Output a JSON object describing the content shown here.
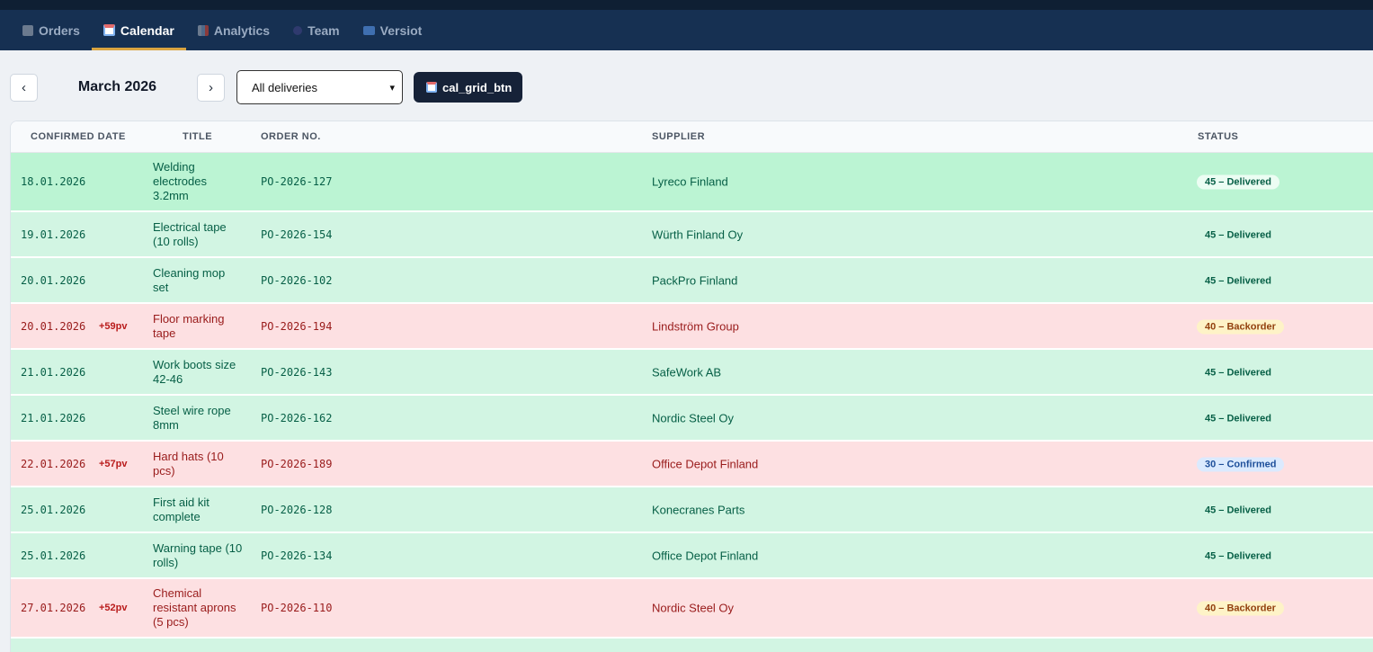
{
  "nav": {
    "tabs": [
      {
        "label": "Orders",
        "icon": "clipboard-icon"
      },
      {
        "label": "Calendar",
        "icon": "calendar-icon",
        "active": true
      },
      {
        "label": "Analytics",
        "icon": "bar-chart-icon"
      },
      {
        "label": "Team",
        "icon": "people-icon"
      },
      {
        "label": "Versiot",
        "icon": "version-icon"
      }
    ]
  },
  "toolbar": {
    "prev_label": "‹",
    "next_label": "›",
    "month": "March 2026",
    "filter_value": "All deliveries",
    "grid_button_label": "cal_grid_btn"
  },
  "table": {
    "headers": {
      "date": "CONFIRMED DATE",
      "title": "TITLE",
      "order": "ORDER NO.",
      "supplier": "SUPPLIER",
      "status": "STATUS"
    },
    "rows": [
      {
        "date": "18.01.2026",
        "late": "",
        "title": "Welding electrodes 3.2mm",
        "order": "PO-2026-127",
        "supplier": "Lyreco Finland",
        "status": "45 – Delivered",
        "tone": "green"
      },
      {
        "date": "19.01.2026",
        "late": "",
        "title": "Electrical tape (10 rolls)",
        "order": "PO-2026-154",
        "supplier": "Würth Finland Oy",
        "status": "45 – Delivered",
        "tone": "green"
      },
      {
        "date": "20.01.2026",
        "late": "",
        "title": "Cleaning mop set",
        "order": "PO-2026-102",
        "supplier": "PackPro Finland",
        "status": "45 – Delivered",
        "tone": "green"
      },
      {
        "date": "20.01.2026",
        "late": "+59pv",
        "title": "Floor marking tape",
        "order": "PO-2026-194",
        "supplier": "Lindström Group",
        "status": "40 – Backorder",
        "tone": "red"
      },
      {
        "date": "21.01.2026",
        "late": "",
        "title": "Work boots size 42-46",
        "order": "PO-2026-143",
        "supplier": "SafeWork AB",
        "status": "45 – Delivered",
        "tone": "green"
      },
      {
        "date": "21.01.2026",
        "late": "",
        "title": "Steel wire rope 8mm",
        "order": "PO-2026-162",
        "supplier": "Nordic Steel Oy",
        "status": "45 – Delivered",
        "tone": "green"
      },
      {
        "date": "22.01.2026",
        "late": "+57pv",
        "title": "Hard hats (10 pcs)",
        "order": "PO-2026-189",
        "supplier": "Office Depot Finland",
        "status": "30 – Confirmed",
        "tone": "red"
      },
      {
        "date": "25.01.2026",
        "late": "",
        "title": "First aid kit complete",
        "order": "PO-2026-128",
        "supplier": "Konecranes Parts",
        "status": "45 – Delivered",
        "tone": "green"
      },
      {
        "date": "25.01.2026",
        "late": "",
        "title": "Warning tape (10 rolls)",
        "order": "PO-2026-134",
        "supplier": "Office Depot Finland",
        "status": "45 – Delivered",
        "tone": "green"
      },
      {
        "date": "27.01.2026",
        "late": "+52pv",
        "title": "Chemical resistant aprons (5 pcs)",
        "order": "PO-2026-110",
        "supplier": "Nordic Steel Oy",
        "status": "40 – Backorder",
        "tone": "red"
      }
    ]
  }
}
